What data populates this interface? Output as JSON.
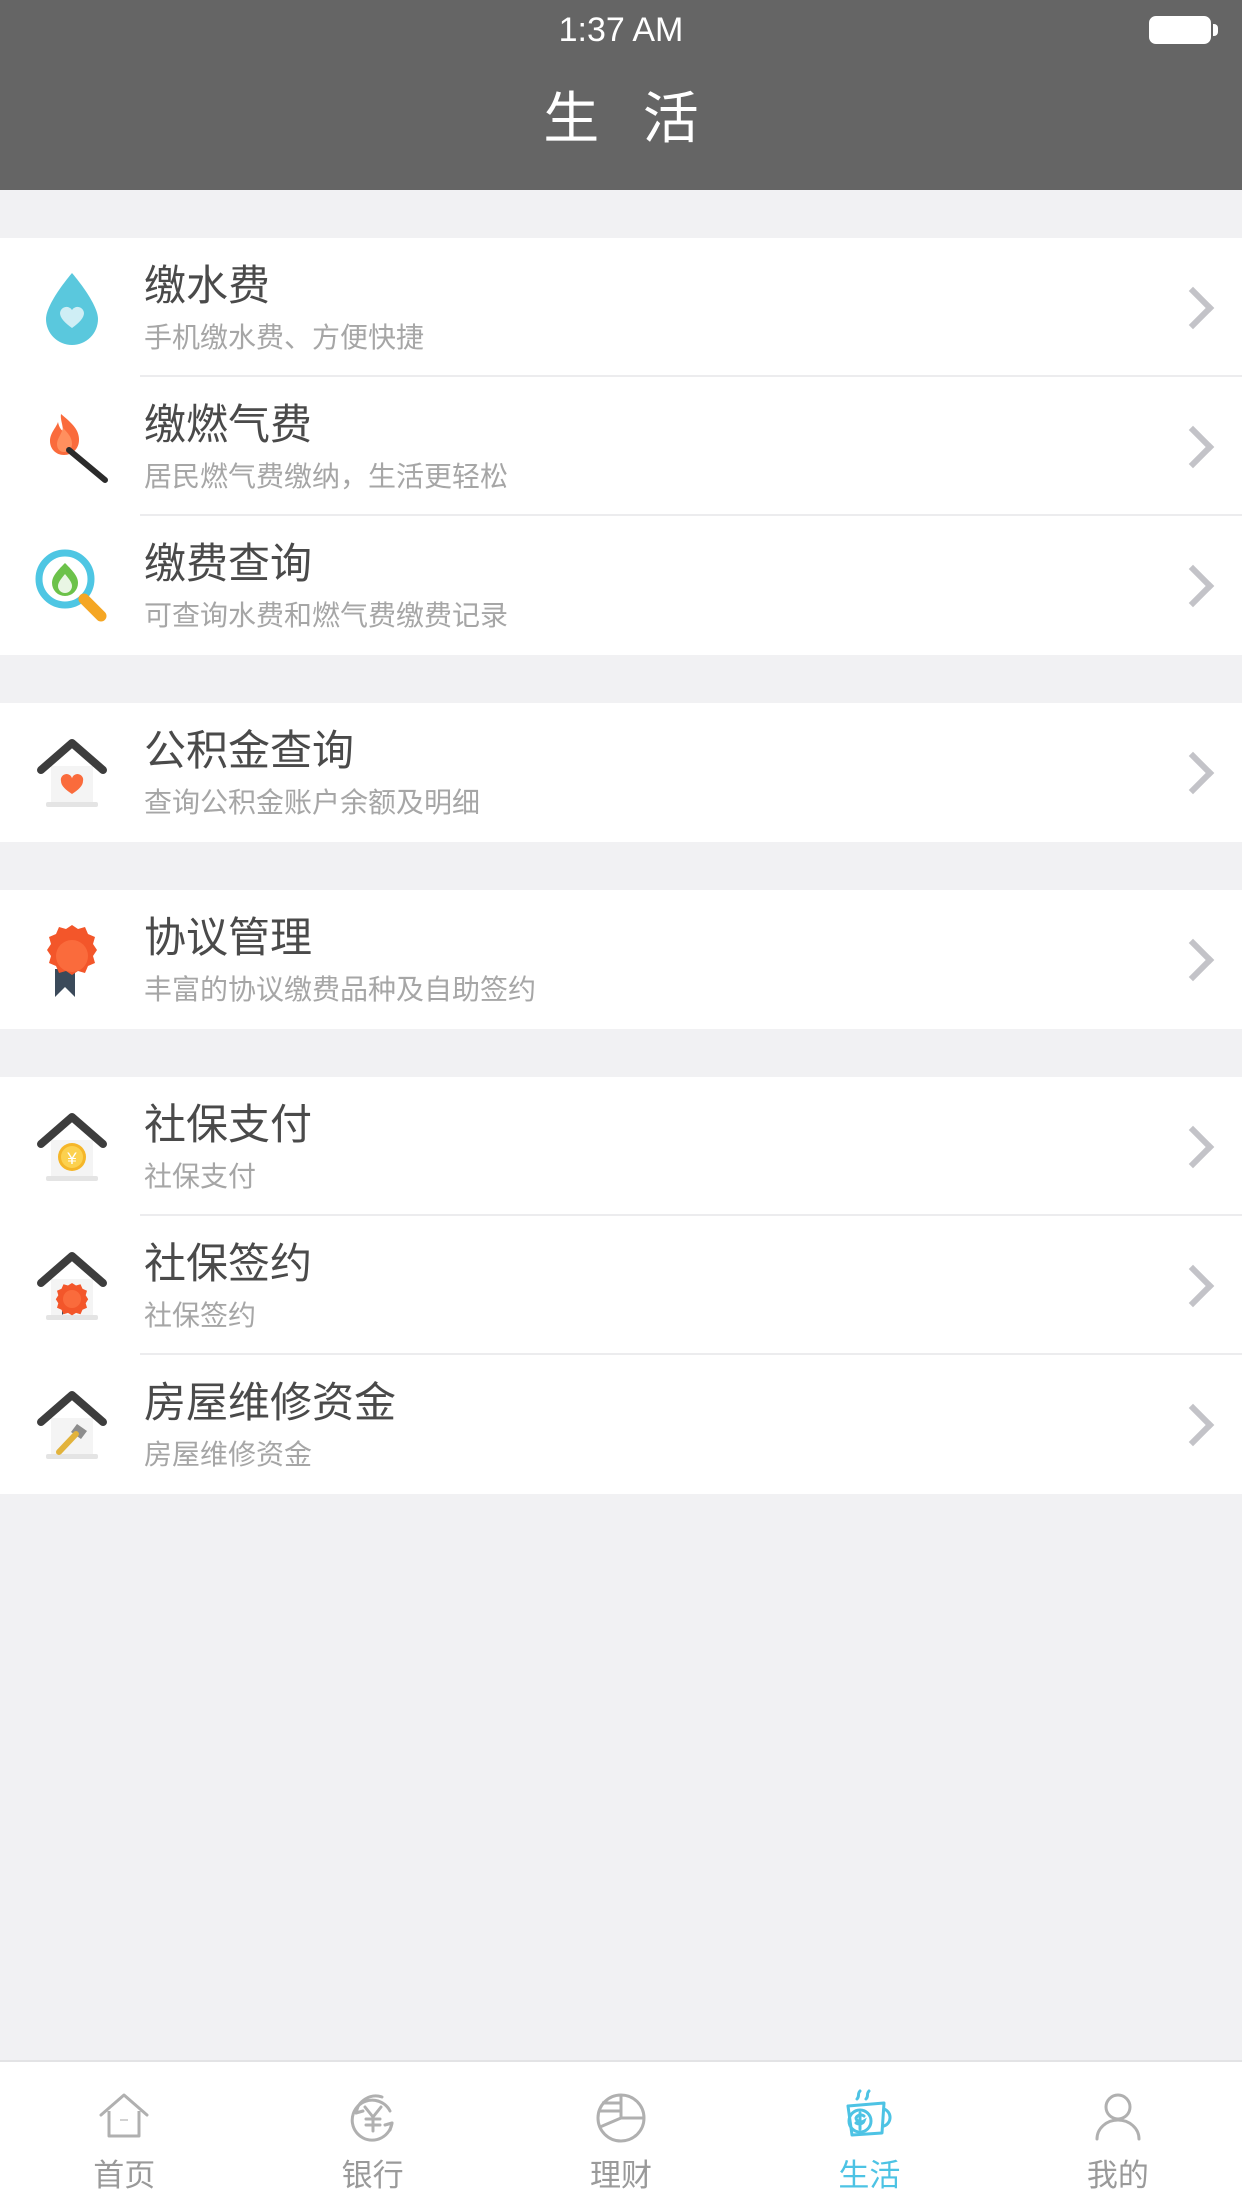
{
  "statusbar": {
    "time": "1:37 AM",
    "battery_icon": "battery-full-icon"
  },
  "header": {
    "title": "生 活",
    "background": "#656565"
  },
  "theme": {
    "accent": "#4dc3e4",
    "title_text": "#4a4a4a",
    "sub_text": "#a6a6a6",
    "chevron": "#c3c3c8",
    "page_bg": "#f1f1f3",
    "card_bg": "#ffffff"
  },
  "sections": [
    {
      "name": "utilities",
      "items": [
        {
          "icon": "water-drop-icon",
          "title": "缴水费",
          "subtitle": "手机缴水费、方便快捷"
        },
        {
          "icon": "match-flame-icon",
          "title": "缴燃气费",
          "subtitle": "居民燃气费缴纳，生活更轻松"
        },
        {
          "icon": "magnifier-flame-icon",
          "title": "缴费查询",
          "subtitle": "可查询水费和燃气费缴费记录"
        }
      ]
    },
    {
      "name": "housing-fund",
      "items": [
        {
          "icon": "house-heart-icon",
          "title": "公积金查询",
          "subtitle": "查询公积金账户余额及明细"
        }
      ]
    },
    {
      "name": "agreements",
      "items": [
        {
          "icon": "award-ribbon-icon",
          "title": "协议管理",
          "subtitle": "丰富的协议缴费品种及自助签约"
        }
      ]
    },
    {
      "name": "social-security",
      "items": [
        {
          "icon": "house-yen-coin-icon",
          "title": "社保支付",
          "subtitle": "社保支付"
        },
        {
          "icon": "house-badge-icon",
          "title": "社保签约",
          "subtitle": "社保签约"
        },
        {
          "icon": "house-hammer-icon",
          "title": "房屋维修资金",
          "subtitle": "房屋维修资金"
        }
      ]
    }
  ],
  "tabbar": {
    "tabs": [
      {
        "icon": "home-outline-icon",
        "label": "首页",
        "active": false
      },
      {
        "icon": "bank-exchange-yen-icon",
        "label": "银行",
        "active": false
      },
      {
        "icon": "pie-chart-icon",
        "label": "理财",
        "active": false
      },
      {
        "icon": "coffee-cup-dollar-icon",
        "label": "生活",
        "active": true
      },
      {
        "icon": "person-outline-icon",
        "label": "我的",
        "active": false
      }
    ]
  }
}
